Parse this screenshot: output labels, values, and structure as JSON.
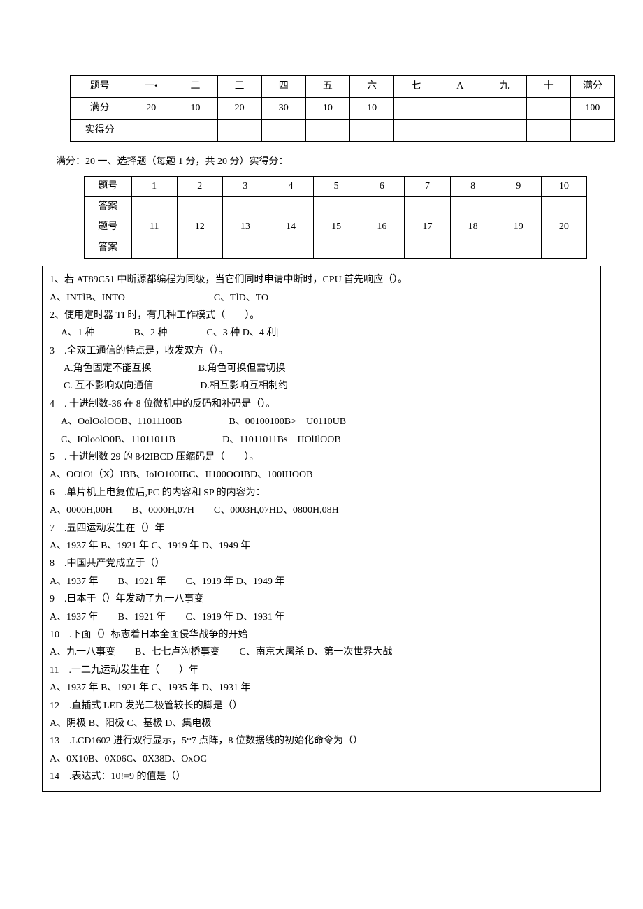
{
  "score_table": {
    "headers": [
      "题号",
      "一•",
      "二",
      "三",
      "四",
      "五",
      "六",
      "七",
      "Λ",
      "九",
      "十",
      "满分"
    ],
    "full": [
      "满分",
      "20",
      "10",
      "20",
      "30",
      "10",
      "10",
      "",
      "",
      "",
      "",
      "100"
    ],
    "actual": [
      "实得分",
      "",
      "",
      "",
      "",
      "",
      "",
      "",
      "",
      "",
      "",
      ""
    ]
  },
  "section1_header": "满分：20 一、选择题（每题 1 分，共 20 分）实得分：",
  "answer_table": {
    "row1h": [
      "题号",
      "1",
      "2",
      "3",
      "4",
      "5",
      "6",
      "7",
      "8",
      "9",
      "10"
    ],
    "row1a": [
      "答案",
      "",
      "",
      "",
      "",
      "",
      "",
      "",
      "",
      "",
      ""
    ],
    "row2h": [
      "题号",
      "11",
      "12",
      "13",
      "14",
      "15",
      "16",
      "17",
      "18",
      "19",
      "20"
    ],
    "row2a": [
      "答案",
      "",
      "",
      "",
      "",
      "",
      "",
      "",
      "",
      "",
      ""
    ]
  },
  "q": {
    "q1": "1、若 AT89C51 中断源都编程为同级，当它们同时申请中断时，CPU 首先响应（）。",
    "q1a": "A、INTlB、INTO",
    "q1c": "C、TlD、TO",
    "q2": "2、使用定时器 TI 时，有几种工作模式（　　）。",
    "q2o": "A、1 种　　　　B、2 种　　　　C、3 种 D、4 利|",
    "q3": "3　.全双工通信的特点是，收发双方（）。",
    "q3a": "A.角色固定不能互换",
    "q3b": "B.角色可换但需切换",
    "q3c": "C. 互不影响双向通信",
    "q3d": "D.相互影响互相制约",
    "q4": "4　. 十进制数-36 在 8 位微机中的反码和补码是（）。",
    "q4a": "A、OolOolOOB、11011100B",
    "q4b": "B、00100100B>　U0110UB",
    "q4c": "C、IOloolO0B、11011011B",
    "q4d": "D、11011011Bs　HOlIlOOB",
    "q5": "5　. 十进制数 29 的 842IBCD 压缩码是（　　）。",
    "q5o": "A、OOiOi（X）IBB、IoIO100IBC、II100OOIBD、100IHOOB",
    "q6": "6　.单片机上电复位后,PC 的内容和 SP 的内容为：",
    "q6o": "A、0000H,00H　　B、0000H,07H　　C、0003H,07HD、0800H,08H",
    "q7": "7　.五四运动发生在（）年",
    "q7o": "A、1937 年 B、1921 年 C、1919 年 D、1949 年",
    "q8": "8　.中国共产党成立于（）",
    "q8o": "A、1937 年　　B、1921 年　　C、1919 年 D、1949 年",
    "q9": "9　.日本于（）年发动了九一八事变",
    "q9o": "A、1937 年　　B、1921 年　　C、1919 年 D、1931 年",
    "q10": "10　.下面（）标志着日本全面侵华战争的开始",
    "q10o": "A、九一八事变　　B、七七卢沟桥事变　　C、南京大屠杀 D、第一次世界大战",
    "q11": "11　.一二九运动发生在（　　）年",
    "q11o": "A、1937 年 B、1921 年 C、1935 年 D、1931 年",
    "q12": "12　.直插式 LED 发光二极管较长的脚是（）",
    "q12o": "A、阴极 B、阳极 C、基极 D、集电极",
    "q13": "13　.LCD1602 进行双行显示，5*7 点阵，8 位数据线的初始化命令为（）",
    "q13o": "A、0X10B、0X06C、0X38D、OxOC",
    "q14": "14　.表达式：10!=9 的值是（）"
  }
}
